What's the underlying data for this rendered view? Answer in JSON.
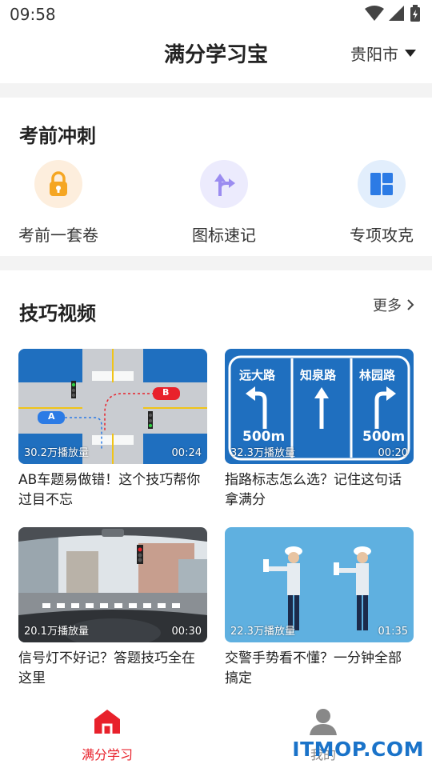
{
  "status_bar": {
    "time": "09:58"
  },
  "header": {
    "title": "满分学习宝",
    "city": "贵阳市"
  },
  "sprint": {
    "title": "考前冲刺",
    "items": [
      {
        "label": "考前一套卷",
        "icon": "lock-icon",
        "color": "#f5a623"
      },
      {
        "label": "图标速记",
        "icon": "direction-sign-icon",
        "color": "#9b8cf0"
      },
      {
        "label": "专项攻克",
        "icon": "grid-icon",
        "color": "#2c7be5"
      }
    ]
  },
  "videos": {
    "title": "技巧视频",
    "more": "更多",
    "items": [
      {
        "views": "30.2万播放量",
        "duration": "00:24",
        "title": "AB车题易做错！这个技巧帮你过目不忘",
        "thumb_labels": [
          "A",
          "B"
        ]
      },
      {
        "views": "32.3万播放量",
        "duration": "00:20",
        "title": "指路标志怎么选？记住这句话拿满分",
        "thumb_labels": [
          "远大路",
          "知泉路",
          "林园路",
          "500m",
          "500m"
        ]
      },
      {
        "views": "20.1万播放量",
        "duration": "00:30",
        "title": "信号灯不好记？答题技巧全在这里"
      },
      {
        "views": "22.3万播放量",
        "duration": "01:35",
        "title": "交警手势看不懂？一分钟全部搞定"
      }
    ]
  },
  "bottom_nav": {
    "items": [
      {
        "label": "满分学习",
        "icon": "home-icon",
        "active": true
      },
      {
        "label": "我的",
        "icon": "user-icon",
        "active": false
      }
    ]
  },
  "watermark": "ITMOP.COM",
  "colors": {
    "accent": "#e8212b",
    "sign_blue": "#1f6fbf",
    "sky": "#5fb0e0"
  }
}
